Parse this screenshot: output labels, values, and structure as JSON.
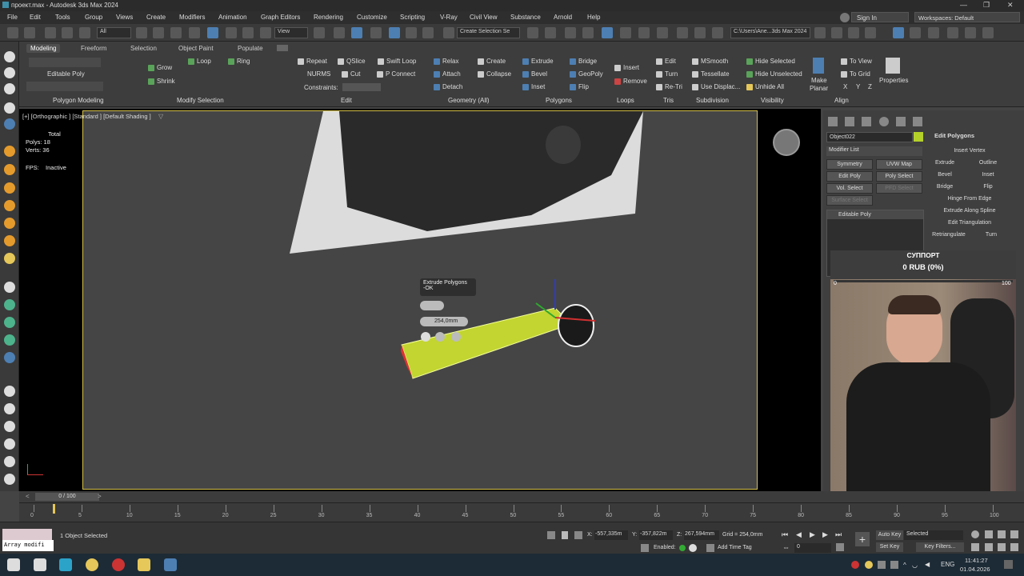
{
  "window": {
    "title": "проект.max - Autodesk 3ds Max 2024"
  },
  "menu": [
    "File",
    "Edit",
    "Tools",
    "Group",
    "Views",
    "Create",
    "Modifiers",
    "Animation",
    "Graph Editors",
    "Rendering",
    "Customize",
    "Scripting",
    "V-Ray",
    "Civil View",
    "Substance",
    "Arnold",
    "Help"
  ],
  "signin": "Sign In",
  "workspaces": "Workspaces: Default",
  "toolbar": {
    "filter": "All",
    "view": "View",
    "selection_set": "Create Selection Se",
    "path": "C:\\Users\\Ane...3ds Max 2024"
  },
  "ribbon": {
    "tabs": [
      "Modeling",
      "Freeform",
      "Selection",
      "Object Paint",
      "Populate"
    ],
    "editable_poly": "Editable Poly",
    "polygon_modeling": "Polygon Modeling",
    "grow": "Grow",
    "shrink": "Shrink",
    "loop": "Loop",
    "ring": "Ring",
    "modify_selection": "Modify Selection",
    "repeat": "Repeat",
    "qslice": "QSlice",
    "swift_loop": "Swift Loop",
    "nurms": "NURMS",
    "cut": "Cut",
    "pconnect": "P Connect",
    "constraints": "Constraints:",
    "edit": "Edit",
    "relax": "Relax",
    "create": "Create",
    "attach": "Attach",
    "collapse": "Collapse",
    "detach": "Detach",
    "geometry_all": "Geometry (All)",
    "extrude": "Extrude",
    "bridge": "Bridge",
    "bevel": "Bevel",
    "geopoly": "GeoPoly",
    "inset": "Inset",
    "flip": "Flip",
    "polygons": "Polygons",
    "insert": "Insert",
    "remove": "Remove",
    "loops": "Loops",
    "edit2": "Edit",
    "turn": "Turn",
    "retri": "Re-Tri",
    "tris": "Tris",
    "msmooth": "MSmooth",
    "tessellate": "Tessellate",
    "use_displac": "Use Displac...",
    "subdivision": "Subdivision",
    "hide_selected": "Hide Selected",
    "hide_unselected": "Hide Unselected",
    "unhide_all": "Unhide All",
    "visibility": "Visibility",
    "make_planar_1": "Make",
    "make_planar_2": "Planar",
    "to_view": "To View",
    "to_grid": "To Grid",
    "x": "X",
    "y": "Y",
    "z": "Z",
    "align": "Align",
    "properties": "Properties"
  },
  "viewport": {
    "label": "[+] [Orthographic ] [Standard ] [Default Shading ]",
    "total": "Total",
    "polys_label": "Polys:",
    "polys": "18",
    "verts_label": "Verts:",
    "verts": "36",
    "fps_label": "FPS:",
    "fps": "Inactive",
    "caddy_title": "Extrude Polygons",
    "caddy_sub": "-OK",
    "caddy_value": "254,0mm"
  },
  "command_panel": {
    "object_name": "Object022",
    "object_color": "#b4d12a",
    "modifier_list": "Modifier List",
    "buttons": [
      "Symmetry",
      "UVW Map",
      "Edit Poly",
      "Poly Select",
      "Vol. Select",
      "PFD Select",
      "Surface Select"
    ],
    "stack_item": "Editable Poly",
    "rollout_title": "Edit Polygons",
    "insert_vertex": "Insert Vertex",
    "extrude": "Extrude",
    "outline": "Outline",
    "bevel": "Bevel",
    "inset": "Inset",
    "bridge": "Bridge",
    "flip": "Flip",
    "hinge": "Hinge From Edge",
    "extrude_spline": "Extrude Along Spline",
    "edit_triangulation": "Edit Triangulation",
    "retriangulate": "Retriangulate",
    "turn": "Turn"
  },
  "donation": {
    "title": "СУППОРТ",
    "amount": "0 RUB (0%)",
    "min": "0",
    "max": "100",
    "progress_fraction": 0
  },
  "timeline": {
    "frame": "0 / 100",
    "ticks": [
      "0",
      "5",
      "10",
      "15",
      "20",
      "25",
      "30",
      "35",
      "40",
      "45",
      "50",
      "55",
      "60",
      "65",
      "70",
      "75",
      "80",
      "85",
      "90",
      "95",
      "100"
    ]
  },
  "status": {
    "script": "Array modifi",
    "selected": "1 Object Selected",
    "x_label": "X:",
    "x": "-557,335m",
    "y_label": "Y:",
    "y": "-357,822m",
    "z_label": "Z:",
    "z": "267,594mm",
    "grid": "Grid = 254,0mm",
    "enabled": "Enabled:",
    "add_time_tag": "Add Time Tag",
    "frame_val": "0",
    "auto_key": "Auto Key",
    "set_key": "Set Key",
    "selected_dd": "Selected",
    "key_filters": "Key Filters..."
  },
  "taskbar": {
    "lang": "ENG",
    "time": "11:41:27",
    "date": "01.04.2026"
  }
}
